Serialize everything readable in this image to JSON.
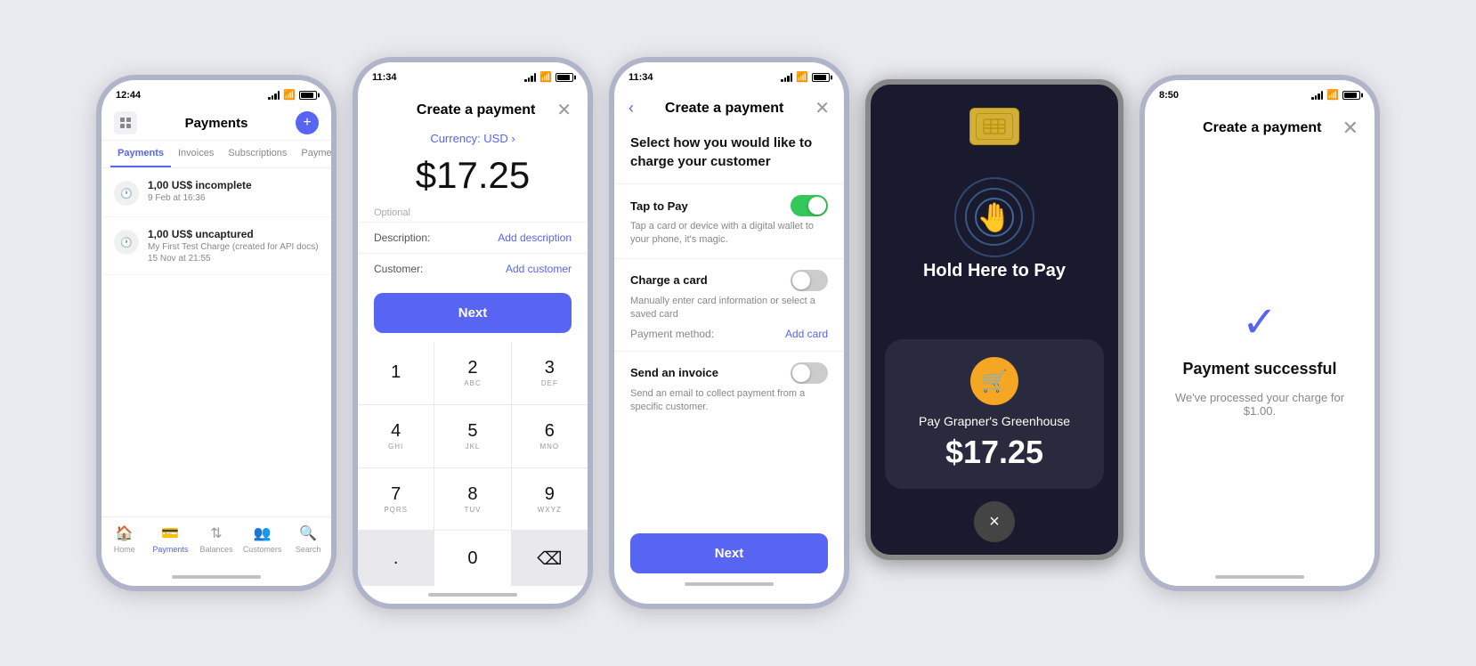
{
  "phone1": {
    "time": "12:44",
    "title": "Payments",
    "tabs": [
      "Payments",
      "Invoices",
      "Subscriptions",
      "Payment links"
    ],
    "active_tab": "Payments",
    "items": [
      {
        "amount": "1,00 US$ incomplete",
        "date": "9 Feb at 16:36",
        "desc": ""
      },
      {
        "amount": "1,00 US$ uncaptured",
        "date": "15 Nov at 21:55",
        "desc": "My First Test Charge (created for API docs)"
      }
    ],
    "nav": [
      "Home",
      "Payments",
      "Balances",
      "Customers",
      "Search"
    ],
    "active_nav": "Payments"
  },
  "phone2": {
    "time": "11:34",
    "title": "Create a payment",
    "currency_label": "Currency: USD ›",
    "amount": "$17.25",
    "optional_label": "Optional",
    "description_label": "Description:",
    "description_action": "Add description",
    "customer_label": "Customer:",
    "customer_action": "Add customer",
    "next_button": "Next",
    "keys": [
      {
        "num": "1",
        "letters": ""
      },
      {
        "num": "2",
        "letters": "ABC"
      },
      {
        "num": "3",
        "letters": "DEF"
      },
      {
        "num": "4",
        "letters": "GHI"
      },
      {
        "num": "5",
        "letters": "JKL"
      },
      {
        "num": "6",
        "letters": "MNO"
      },
      {
        "num": "7",
        "letters": "PQRS"
      },
      {
        "num": "8",
        "letters": "TUV"
      },
      {
        "num": "9",
        "letters": "WXYZ"
      },
      {
        "num": ".",
        "letters": ""
      },
      {
        "num": "0",
        "letters": ""
      },
      {
        "num": "⌫",
        "letters": ""
      }
    ]
  },
  "phone3": {
    "time": "11:34",
    "title": "Create a payment",
    "subtitle": "Select how you would like to charge your customer",
    "options": [
      {
        "title": "Tap to Pay",
        "desc": "Tap a card or device with a digital wallet to your phone, it's magic.",
        "toggle": "on",
        "action_label": ""
      },
      {
        "title": "Charge a card",
        "desc": "Manually enter card information or select a saved card",
        "toggle": "off",
        "action_label": "Add card",
        "action_field": "Payment method:"
      },
      {
        "title": "Send an invoice",
        "desc": "Send an email to collect payment from a specific customer.",
        "toggle": "off",
        "action_label": ""
      }
    ],
    "next_button": "Next"
  },
  "nfc": {
    "merchant_name": "Pay Grapner's Greenhouse",
    "amount": "$17.25",
    "hold_text": "Hold Here to Pay",
    "cancel_icon": "×"
  },
  "phone5": {
    "time": "8:50",
    "title": "Create a payment",
    "success_title": "Payment successful",
    "success_desc": "We've processed your charge for $1.00."
  }
}
